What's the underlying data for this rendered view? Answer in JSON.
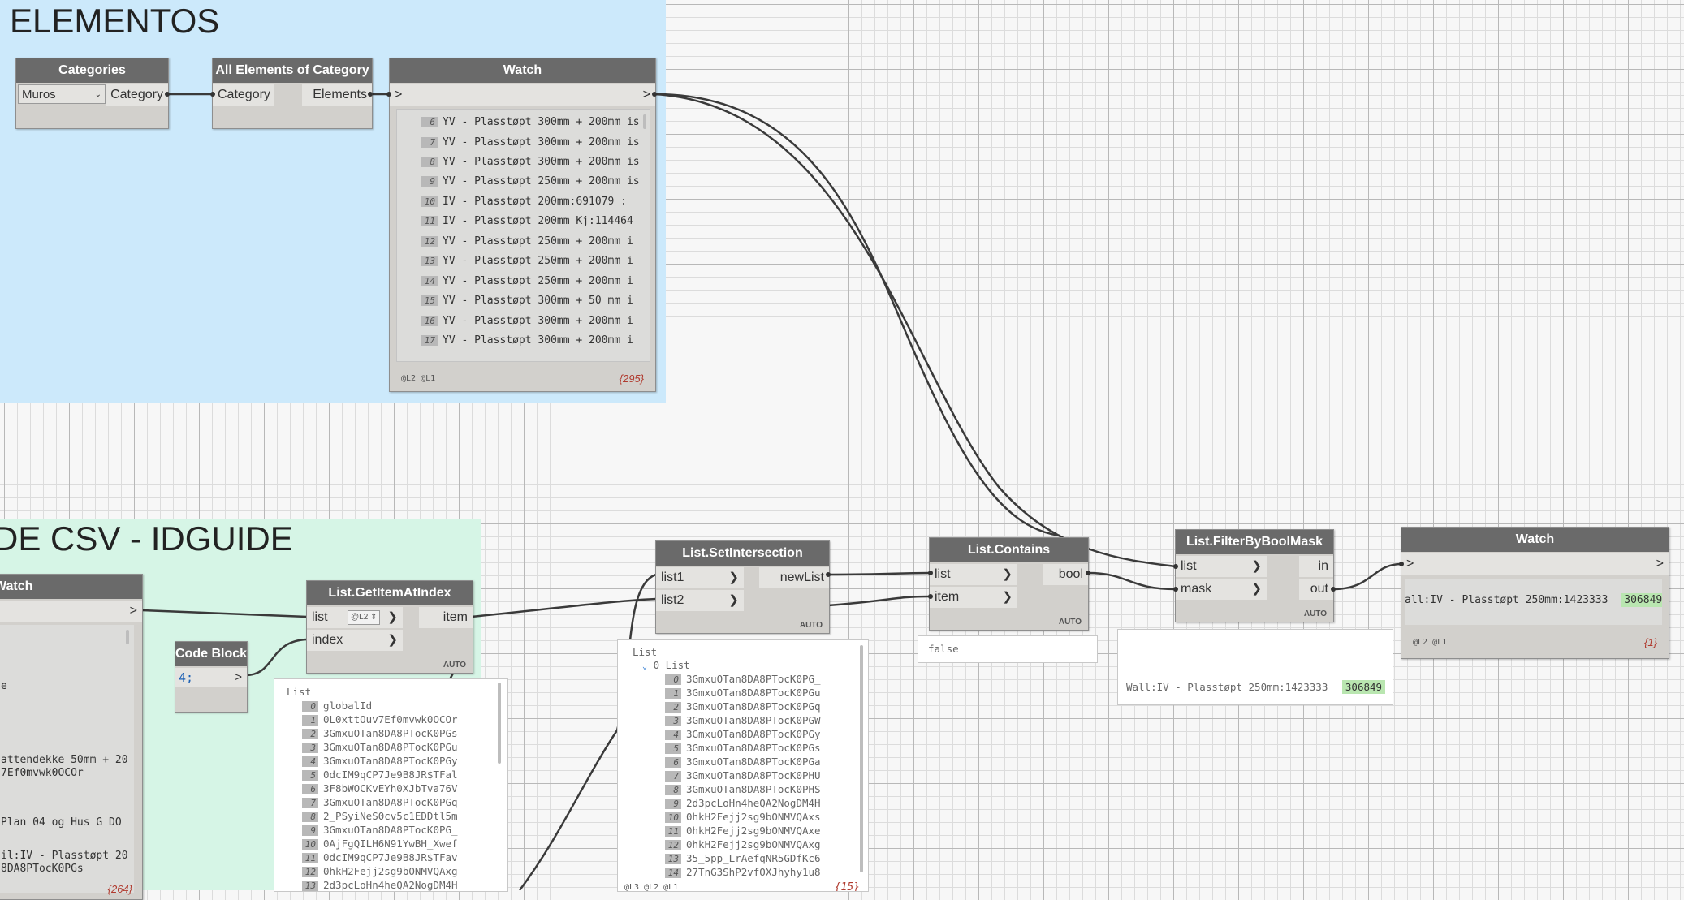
{
  "groups": {
    "elementos": "ELEMENTOS",
    "csv": "DE CSV - IDGUIDE"
  },
  "nodes": {
    "categories": {
      "title": "Categories",
      "dropdown_value": "Muros",
      "output": "Category"
    },
    "all_elements": {
      "title": "All Elements of Category",
      "input": "Category",
      "output": "Elements"
    },
    "watch1": {
      "title": "Watch",
      "in_port": ">",
      "out_port": ">",
      "rows": [
        {
          "idx": "6",
          "text": "YV - Plasstøpt 300mm + 200mm is"
        },
        {
          "idx": "7",
          "text": "YV - Plasstøpt 300mm + 200mm is"
        },
        {
          "idx": "8",
          "text": "YV - Plasstøpt 300mm + 200mm is"
        },
        {
          "idx": "9",
          "text": "YV - Plasstøpt 250mm + 200mm is"
        },
        {
          "idx": "10",
          "text": "IV - Plasstøpt 200mm:691079 :"
        },
        {
          "idx": "11",
          "text": "IV - Plasstøpt 200mm Kj:114464"
        },
        {
          "idx": "12",
          "text": "YV - Plasstøpt 250mm + 200mm i"
        },
        {
          "idx": "13",
          "text": "YV - Plasstøpt 250mm + 200mm i"
        },
        {
          "idx": "14",
          "text": "YV - Plasstøpt 250mm + 200mm i"
        },
        {
          "idx": "15",
          "text": "YV - Plasstøpt 300mm + 50 mm i"
        },
        {
          "idx": "16",
          "text": "YV - Plasstøpt 300mm + 200mm i"
        },
        {
          "idx": "17",
          "text": "YV - Plasstøpt 300mm + 200mm i"
        }
      ],
      "levels": "@L2 @L1",
      "count": "{295}"
    },
    "watch_left": {
      "title": "Watch",
      "out_port": ">",
      "rows": [
        "e",
        "attendekke 50mm + 20",
        "7Ef0mvwk0OCOr",
        "Plan 04 og Hus G DO",
        "il:IV - Plasstøpt 20",
        "8DA8PTocK0PGs"
      ],
      "count": "{264}"
    },
    "code_block": {
      "title": "Code Block",
      "code": "4;",
      "out_port": ">"
    },
    "get_item": {
      "title": "List.GetItemAtIndex",
      "in1": "list",
      "in2": "index",
      "lacing": "@L2",
      "output": "item",
      "auto": "AUTO"
    },
    "set_intersection": {
      "title": "List.SetIntersection",
      "in1": "list1",
      "in2": "list2",
      "output": "newList",
      "auto": "AUTO"
    },
    "contains": {
      "title": "List.Contains",
      "in1": "list",
      "in2": "item",
      "output": "bool",
      "auto": "AUTO",
      "preview": "false"
    },
    "filter": {
      "title": "List.FilterByBoolMask",
      "in1": "list",
      "in2": "mask",
      "out1": "in",
      "out2": "out",
      "auto": "AUTO",
      "preview_text": "Wall:IV - Plasstøpt 250mm:1423333",
      "preview_id": "306849"
    },
    "watch2": {
      "title": "Watch",
      "in_port": ">",
      "out_port": ">",
      "row_text": "all:IV - Plasstøpt 250mm:1423333",
      "row_id": "306849",
      "levels": "@L2 @L1",
      "count": "{1}"
    }
  },
  "previews": {
    "get_item": {
      "header": "List",
      "rows": [
        {
          "idx": "0",
          "text": "globalId"
        },
        {
          "idx": "1",
          "text": "0L0xttOuv7Ef0mvwk0OCOr"
        },
        {
          "idx": "2",
          "text": "3GmxuOTan8DA8PTocK0PGs"
        },
        {
          "idx": "3",
          "text": "3GmxuOTan8DA8PTocK0PGu"
        },
        {
          "idx": "4",
          "text": "3GmxuOTan8DA8PTocK0PGy"
        },
        {
          "idx": "5",
          "text": "0dcIM9qCP7Je9B8JR$TFal"
        },
        {
          "idx": "6",
          "text": "3F8bWOCKvEYh0XJbTva76V"
        },
        {
          "idx": "7",
          "text": "3GmxuOTan8DA8PTocK0PGq"
        },
        {
          "idx": "8",
          "text": "2_PSyiNeS0cv5c1EDDtl5m"
        },
        {
          "idx": "9",
          "text": "3GmxuOTan8DA8PTocK0PG_"
        },
        {
          "idx": "10",
          "text": "0AjFgQILH6N91YwBH_Xwef"
        },
        {
          "idx": "11",
          "text": "0dcIM9qCP7Je9B8JR$TFav"
        },
        {
          "idx": "12",
          "text": "0hkH2Fejj2sg9bONMVQAxg"
        },
        {
          "idx": "13",
          "text": "2d3pcLoHn4heQA2NogDM4H"
        }
      ]
    },
    "set_intersection": {
      "header": "List",
      "sub": "0 List",
      "rows": [
        {
          "idx": "0",
          "text": "3GmxuOTan8DA8PTocK0PG_"
        },
        {
          "idx": "1",
          "text": "3GmxuOTan8DA8PTocK0PGu"
        },
        {
          "idx": "2",
          "text": "3GmxuOTan8DA8PTocK0PGq"
        },
        {
          "idx": "3",
          "text": "3GmxuOTan8DA8PTocK0PGW"
        },
        {
          "idx": "4",
          "text": "3GmxuOTan8DA8PTocK0PGy"
        },
        {
          "idx": "5",
          "text": "3GmxuOTan8DA8PTocK0PGs"
        },
        {
          "idx": "6",
          "text": "3GmxuOTan8DA8PTocK0PGa"
        },
        {
          "idx": "7",
          "text": "3GmxuOTan8DA8PTocK0PHU"
        },
        {
          "idx": "8",
          "text": "3GmxuOTan8DA8PTocK0PHS"
        },
        {
          "idx": "9",
          "text": "2d3pcLoHn4heQA2NogDM4H"
        },
        {
          "idx": "10",
          "text": "0hkH2Fejj2sg9bONMVQAxs"
        },
        {
          "idx": "11",
          "text": "0hkH2Fejj2sg9bONMVQAxe"
        },
        {
          "idx": "12",
          "text": "0hkH2Fejj2sg9bONMVQAxg"
        },
        {
          "idx": "13",
          "text": "35_5pp_LrAefqNR5GDfKc6"
        },
        {
          "idx": "14",
          "text": "27TnG3ShP2vfOXJhyhy1u8"
        }
      ],
      "footer_levels": "@L3 @L2 @L1",
      "count": "{15}"
    }
  },
  "colors": {
    "group_blue": "#cce9fb",
    "group_green": "#d6f5e6",
    "node_header": "#6a6a6a",
    "node_body": "#d2d0cc",
    "wire": "#3a3a3a",
    "highlight_green": "#b9e6b0"
  }
}
